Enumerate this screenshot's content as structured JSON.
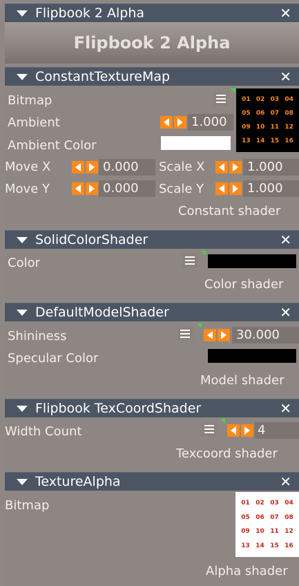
{
  "colors": {
    "header_bg": "#4b5563",
    "panel_bg": "#8e8682",
    "accent_orange": "#ff8a1c",
    "green_marker": "#3fd64a"
  },
  "flipbook_alpha": {
    "header_title": "Flipbook 2 Alpha",
    "banner_title": "Flipbook 2 Alpha",
    "close": "✕"
  },
  "constant_texture_map": {
    "header_title": "ConstantTextureMap",
    "close": "✕",
    "bitmap_label": "Bitmap",
    "ambient_label": "Ambient",
    "ambient_value": "1.000",
    "ambient_color_label": "Ambient Color",
    "ambient_color": "#ffffff",
    "move_x_label": "Move X",
    "move_x_value": "0.000",
    "scale_x_label": "Scale X",
    "scale_x_value": "1.000",
    "move_y_label": "Move Y",
    "move_y_value": "0.000",
    "scale_y_label": "Scale Y",
    "scale_y_value": "1.000",
    "footer": "Constant shader",
    "texture_cells": [
      "01",
      "02",
      "03",
      "04",
      "05",
      "06",
      "07",
      "08",
      "09",
      "10",
      "11",
      "12",
      "13",
      "14",
      "15",
      "16"
    ]
  },
  "solid_color_shader": {
    "header_title": "SolidColorShader",
    "close": "✕",
    "color_label": "Color",
    "color_value": "#000000",
    "footer": "Color shader"
  },
  "default_model_shader": {
    "header_title": "DefaultModelShader",
    "close": "✕",
    "shininess_label": "Shininess",
    "shininess_value": "30.000",
    "specular_color_label": "Specular Color",
    "specular_color": "#000000",
    "footer": "Model shader"
  },
  "flipbook_texcoord_shader": {
    "header_title": "Flipbook TexCoordShader",
    "close": "✕",
    "width_count_label": "Width Count",
    "width_count_value": "4",
    "footer": "Texcoord shader"
  },
  "texture_alpha": {
    "header_title": "TextureAlpha",
    "close": "✕",
    "bitmap_label": "Bitmap",
    "footer": "Alpha shader",
    "texture_cells": [
      "01",
      "02",
      "03",
      "04",
      "05",
      "06",
      "07",
      "08",
      "09",
      "10",
      "11",
      "12",
      "13",
      "14",
      "15",
      "16"
    ]
  }
}
